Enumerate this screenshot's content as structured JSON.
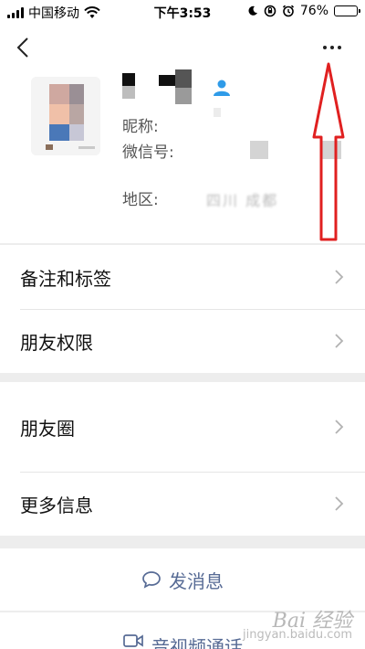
{
  "status_bar": {
    "carrier": "中国移动",
    "time": "下午3:53",
    "battery_percent": "76%",
    "battery_level": 0.76
  },
  "profile": {
    "name_hidden": true,
    "nickname_label": "昵称:",
    "wechat_id_label": "微信号:",
    "region_label": "地区:",
    "region_value": "四川 成都"
  },
  "menu": {
    "group1": [
      {
        "label": "备注和标签"
      },
      {
        "label": "朋友权限"
      }
    ],
    "group2": [
      {
        "label": "朋友圈"
      },
      {
        "label": "更多信息"
      }
    ]
  },
  "actions": {
    "send_message": "发消息",
    "av_call": "音视频通话"
  },
  "watermark": {
    "logo": "Bai 经验",
    "url": "jingyan.baidu.com"
  },
  "colors": {
    "link_blue": "#576b95",
    "annotation_red": "#e02020",
    "background": "#ededed"
  }
}
